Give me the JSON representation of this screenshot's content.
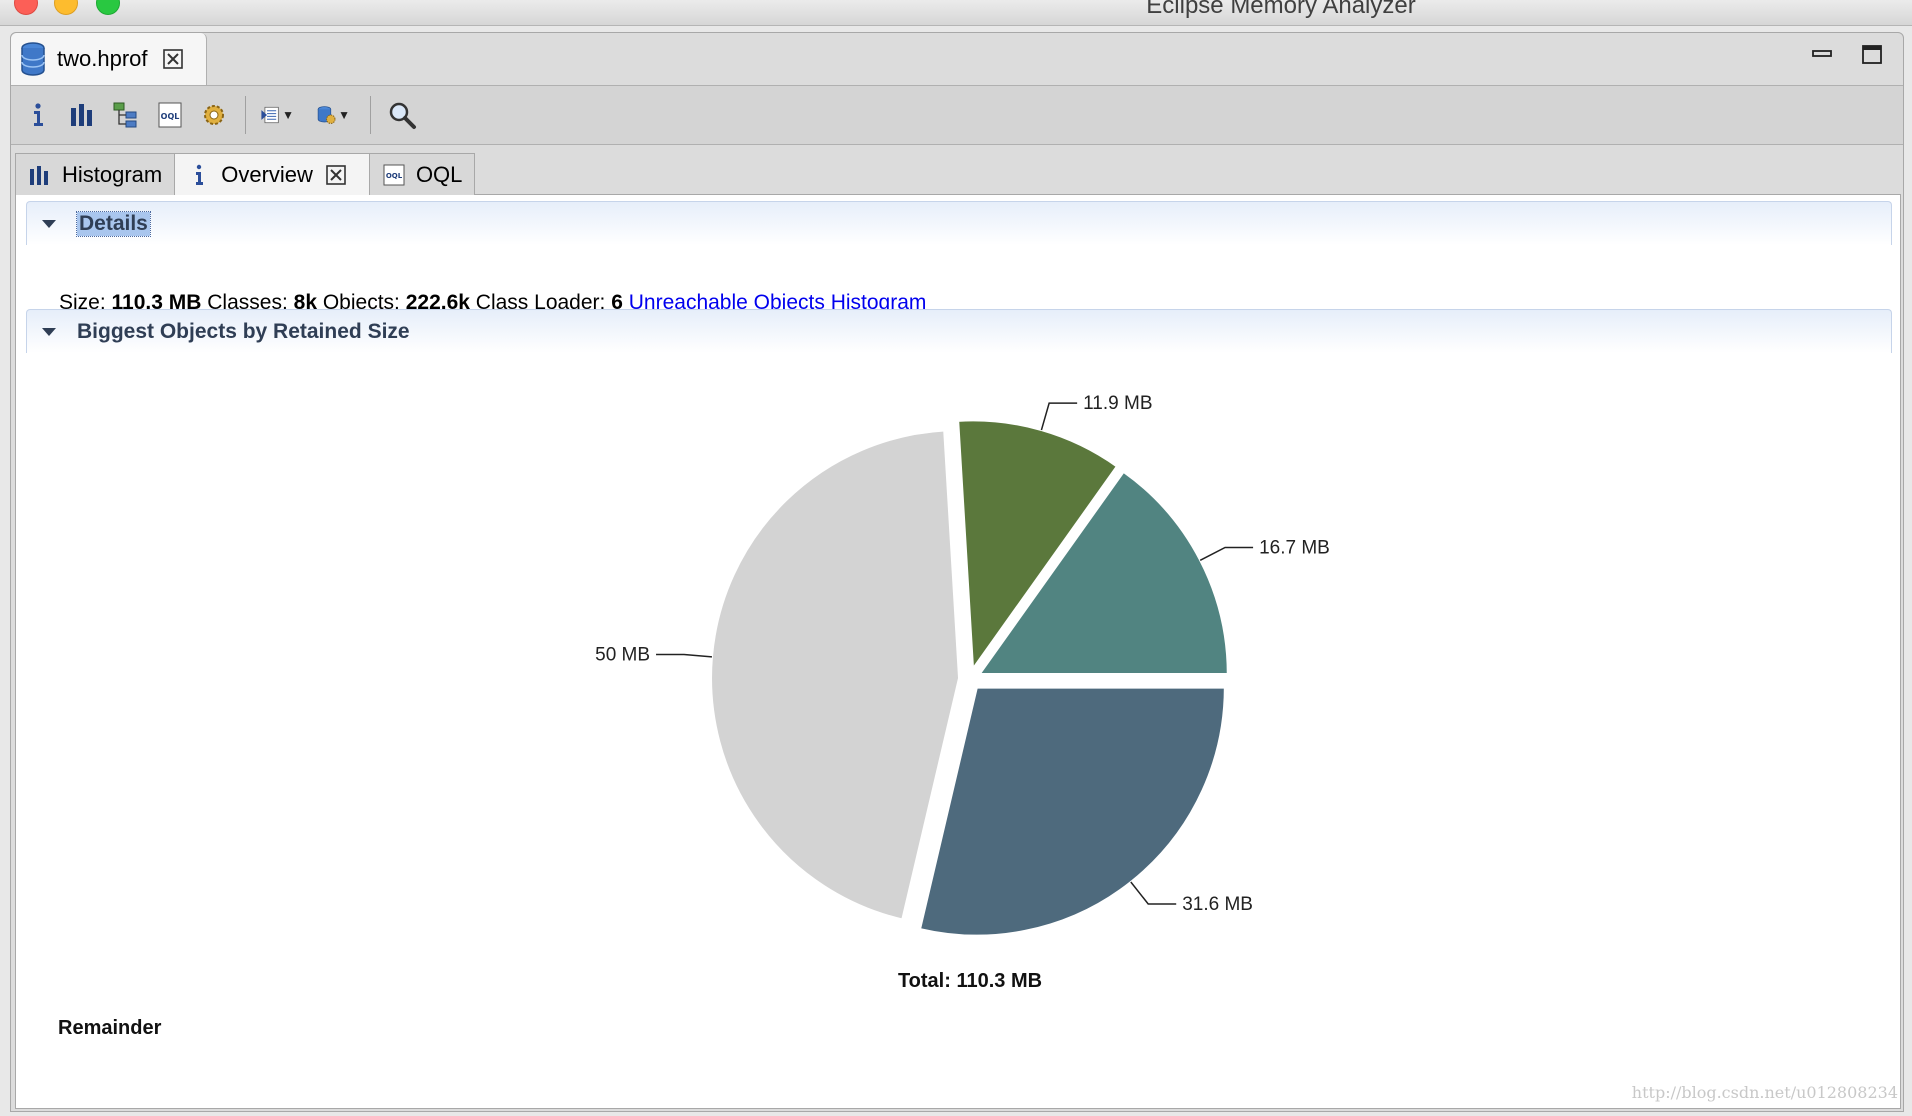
{
  "window": {
    "title": "Eclipse Memory Analyzer"
  },
  "editor": {
    "file_tab_label": "two.hprof"
  },
  "inner_tabs": [
    {
      "label": "Histogram",
      "icon": "histogram-icon"
    },
    {
      "label": "Overview",
      "icon": "info-icon",
      "active": true
    },
    {
      "label": "OQL",
      "icon": "oql-icon"
    }
  ],
  "details": {
    "header": "Details",
    "size_label": "Size:",
    "size_value": "110.3 MB",
    "classes_label": "Classes:",
    "classes_value": "8k",
    "objects_label": "Objects:",
    "objects_value": "222.6k",
    "loader_label": "Class Loader:",
    "loader_value": "6",
    "link": "Unreachable Objects Histogram"
  },
  "biggest": {
    "header": "Biggest Objects by Retained Size",
    "remainder_label": "Remainder"
  },
  "chart_data": {
    "type": "pie",
    "total_label": "Total: 110.3 MB",
    "slices": [
      {
        "label": "31.6 MB",
        "value": 31.6,
        "color": "#4e6a7d"
      },
      {
        "label": "50 MB",
        "value": 50.0,
        "color": "#d3d3d3"
      },
      {
        "label": "11.9 MB",
        "value": 11.9,
        "color": "#5b783c"
      },
      {
        "label": "16.7 MB",
        "value": 16.7,
        "color": "#518481"
      }
    ]
  },
  "watermark": "http://blog.csdn.net/u012808234"
}
